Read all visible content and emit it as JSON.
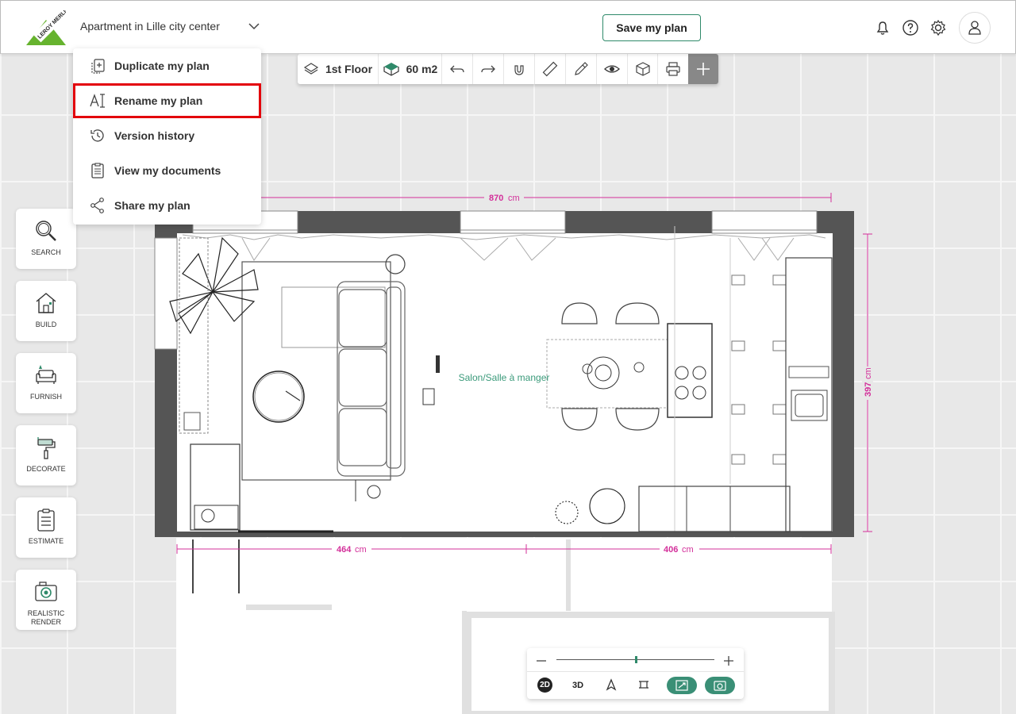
{
  "header": {
    "plan_title": "Apartment in Lille city center",
    "save_label": "Save my plan",
    "logo_text": "LEROY MERLIN"
  },
  "menu": {
    "items": [
      {
        "label": "Duplicate my plan",
        "icon": "duplicate-icon"
      },
      {
        "label": "Rename my plan",
        "icon": "rename-icon",
        "highlighted": true
      },
      {
        "label": "Version history",
        "icon": "history-icon"
      },
      {
        "label": "View my documents",
        "icon": "documents-icon"
      },
      {
        "label": "Share my plan",
        "icon": "share-icon"
      }
    ]
  },
  "toolbar": {
    "floor_label": "1st Floor",
    "area_label": "60 m2"
  },
  "sidebar": {
    "items": [
      {
        "label": "SEARCH",
        "icon": "search-icon"
      },
      {
        "label": "BUILD",
        "icon": "house-icon"
      },
      {
        "label": "FURNISH",
        "icon": "sofa-icon"
      },
      {
        "label": "DECORATE",
        "icon": "paint-roller-icon"
      },
      {
        "label": "ESTIMATE",
        "icon": "clipboard-icon"
      },
      {
        "label": "REALISTIC RENDER",
        "icon": "camera-icon"
      }
    ]
  },
  "plan": {
    "room_label": "Salon/Salle à manger",
    "dim_top": "870",
    "dim_right": "397",
    "dim_bottom_left": "464",
    "dim_bottom_right": "406",
    "unit": "cm"
  },
  "zoom": {
    "view_2d": "2D",
    "view_3d": "3D",
    "zoom_level": 0.5
  },
  "colors": {
    "accent_green": "#2f8a6a",
    "dimension_magenta": "#d32f9a",
    "highlight_red": "#e3000b",
    "wall_gray": "#555555"
  }
}
